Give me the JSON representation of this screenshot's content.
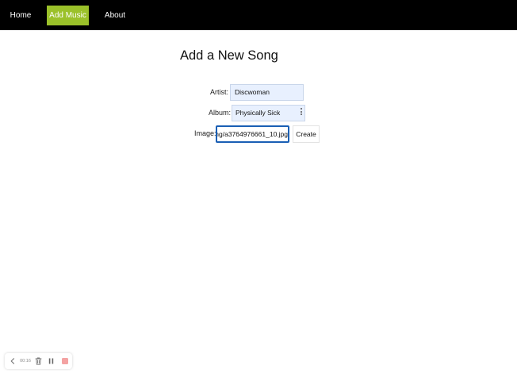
{
  "nav": {
    "home": "Home",
    "add_music": "Add Music",
    "about": "About",
    "active_color": "#9bc12a"
  },
  "form": {
    "title": "Add a New Song",
    "artist_label": "Artist:",
    "artist_value": "Discwoman",
    "album_label": "Album:",
    "album_value": "Physically Sick",
    "image_label": "Image:",
    "image_value": "ng/a3764976661_10.jpg",
    "create_label": "Create"
  },
  "recorder": {
    "time": "00:16",
    "icons": [
      "chevron-left-icon",
      "trash-icon",
      "pause-icon",
      "stop-icon"
    ],
    "stop_color": "#f4a3a3"
  }
}
